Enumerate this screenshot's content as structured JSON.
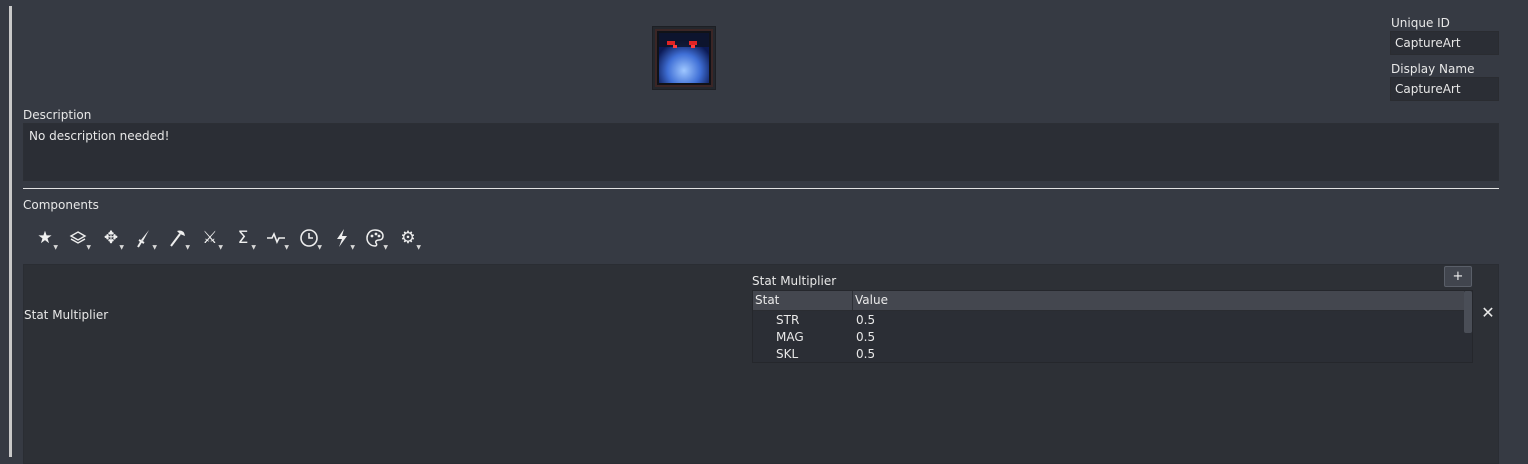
{
  "header": {
    "unique_id_label": "Unique ID",
    "unique_id_value": "CaptureArt",
    "display_name_label": "Display Name",
    "display_name_value": "CaptureArt",
    "icon_name": "dark-ghost-portrait"
  },
  "description": {
    "label": "Description",
    "value": "No description needed!"
  },
  "components": {
    "label": "Components",
    "toolbar": [
      {
        "icon": "star-icon"
      },
      {
        "icon": "layers-icon"
      },
      {
        "icon": "move-arrows-icon"
      },
      {
        "icon": "sword-icon"
      },
      {
        "icon": "axe-icon"
      },
      {
        "icon": "crossed-swords-icon"
      },
      {
        "icon": "sigma-icon"
      },
      {
        "icon": "pulse-icon"
      },
      {
        "icon": "clock-icon"
      },
      {
        "icon": "lightning-icon"
      },
      {
        "icon": "palette-icon"
      },
      {
        "icon": "gear-icon"
      }
    ]
  },
  "stat_component": {
    "name": "Stat Multiplier",
    "table_title": "Stat Multiplier",
    "add_label": "+",
    "remove_label": "✕",
    "columns": [
      "Stat",
      "Value"
    ],
    "rows": [
      {
        "stat": "STR",
        "value": "0.5"
      },
      {
        "stat": "MAG",
        "value": "0.5"
      },
      {
        "stat": "SKL",
        "value": "0.5"
      }
    ]
  }
}
